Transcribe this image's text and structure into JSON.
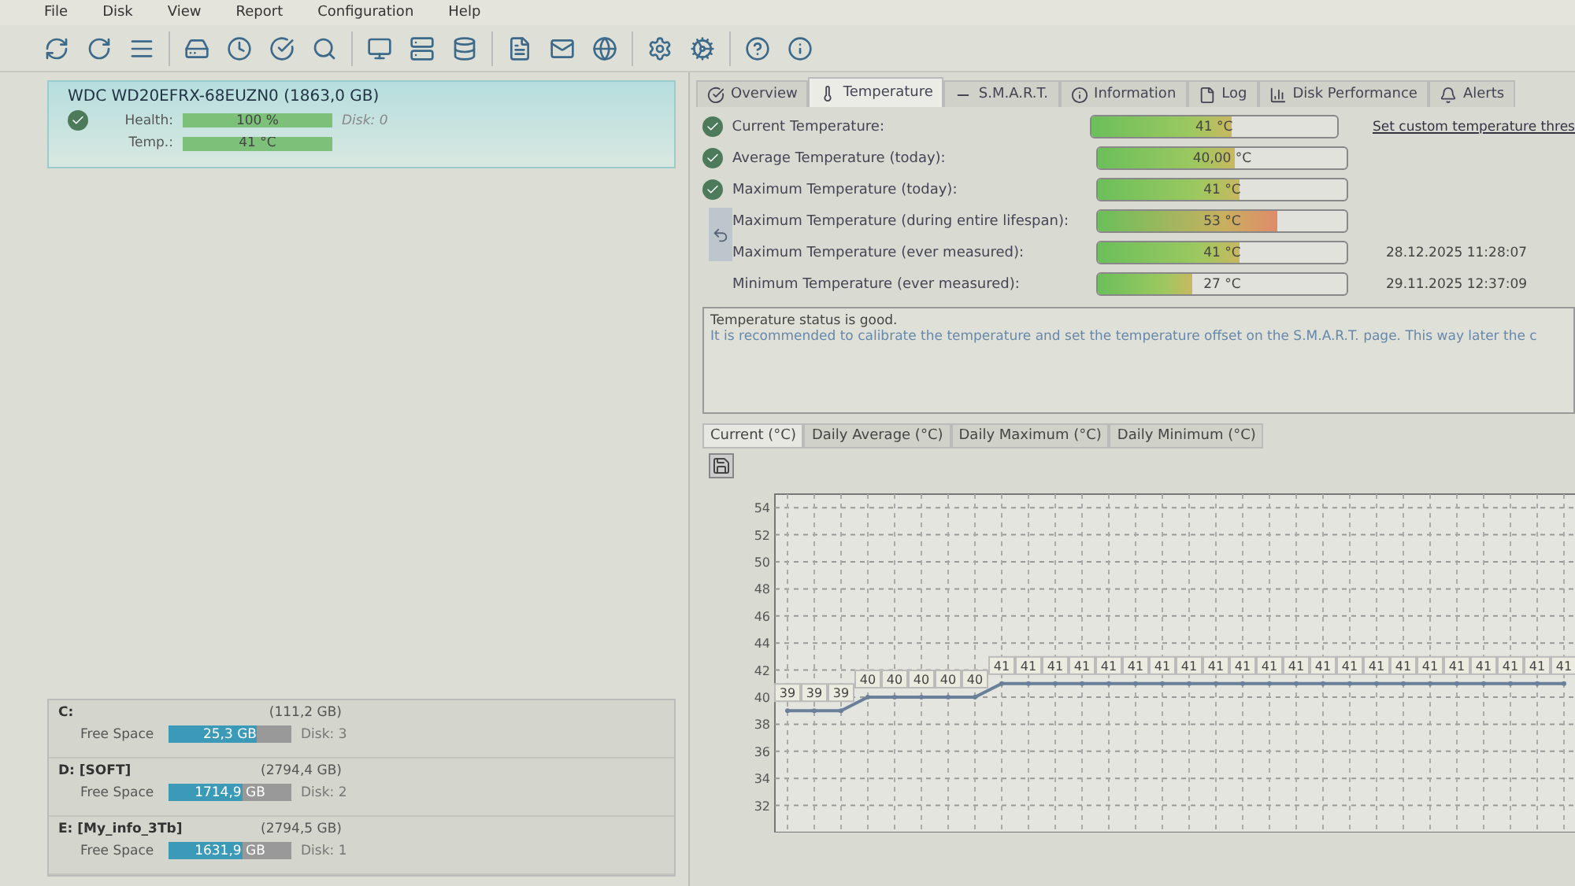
{
  "menu": [
    "File",
    "Disk",
    "View",
    "Report",
    "Configuration",
    "Help"
  ],
  "disk": {
    "title": "WDC WD20EFRX-68EUZN0",
    "size": "(1863,0 GB)",
    "health_label": "Health:",
    "health": "100 %",
    "disk_label": "Disk: 0",
    "temp_label": "Temp.:",
    "temp": "41 °C",
    "selected": true
  },
  "volumes": [
    {
      "name": "C:",
      "size": "(111,2 GB)",
      "free_label": "Free Space",
      "free": "25,3 GB",
      "level": 0.72,
      "disk": "Disk: 3"
    },
    {
      "name": "D: [SOFT]",
      "size": "(2794,4 GB)",
      "free_label": "Free Space",
      "free": "1714,9 GB",
      "level": 0.6,
      "disk": "Disk: 2"
    },
    {
      "name": "E: [My_info_3Tb]",
      "size": "(2794,5 GB)",
      "free_label": "Free Space",
      "free": "1631,9 GB",
      "level": 0.6,
      "disk": "Disk: 1"
    }
  ],
  "tabs": [
    {
      "label": "Overview",
      "selected": false
    },
    {
      "label": "Temperature",
      "selected": true
    },
    {
      "label": "S.M.A.R.T.",
      "selected": false
    },
    {
      "label": "Information",
      "selected": false
    },
    {
      "label": "Log",
      "selected": false
    },
    {
      "label": "Disk Performance",
      "selected": false
    },
    {
      "label": "Alerts",
      "selected": false
    }
  ],
  "temperatures": [
    {
      "label": "Current Temperature:",
      "value": "41 °C",
      "level": 0.57,
      "ok": true
    },
    {
      "label": "Average Temperature (today):",
      "value": "40,00 °C",
      "level": 0.55,
      "ok": true
    },
    {
      "label": "Maximum Temperature (today):",
      "value": "41 °C",
      "level": 0.57,
      "ok": true
    },
    {
      "label": "Maximum Temperature (during entire lifespan):",
      "value": "53 °C",
      "level": 0.72,
      "ok": false
    },
    {
      "label": "Maximum Temperature (ever measured):",
      "value": "41 °C",
      "level": 0.57,
      "ok": false,
      "date": "28.12.2025 11:28:07"
    },
    {
      "label": "Minimum Temperature (ever measured):",
      "value": "27 °C",
      "level": 0.38,
      "ok": false,
      "date": "29.11.2025 12:37:09"
    }
  ],
  "threshold_link": "Set custom temperature thres",
  "status": {
    "line_1": "Temperature status is good.",
    "line_2": "It is recommended to calibrate the temperature and set the temperature offset on the S.M.A.R.T. page. This way later the c"
  },
  "chart_tabs": [
    {
      "label": "Current (°C)",
      "selected": true
    },
    {
      "label": "Daily Average (°C)",
      "selected": false
    },
    {
      "label": "Daily Maximum (°C)",
      "selected": false
    },
    {
      "label": "Daily Minimum (°C)",
      "selected": false
    }
  ],
  "chart_data": {
    "type": "line",
    "ylim": [
      30,
      55
    ],
    "yticks": [
      32,
      34,
      36,
      38,
      40,
      42,
      44,
      46,
      48,
      50,
      52,
      54
    ],
    "data_labels": true,
    "grid": true,
    "series": [
      {
        "color": "#6a7f9a",
        "marker": "circle",
        "values": [
          39,
          39,
          39,
          40,
          40,
          40,
          40,
          40,
          41,
          41,
          41,
          41,
          41,
          41,
          41,
          41,
          41,
          41,
          41,
          41,
          41,
          41,
          41,
          41,
          41,
          41,
          41,
          41,
          41,
          41
        ]
      }
    ]
  }
}
